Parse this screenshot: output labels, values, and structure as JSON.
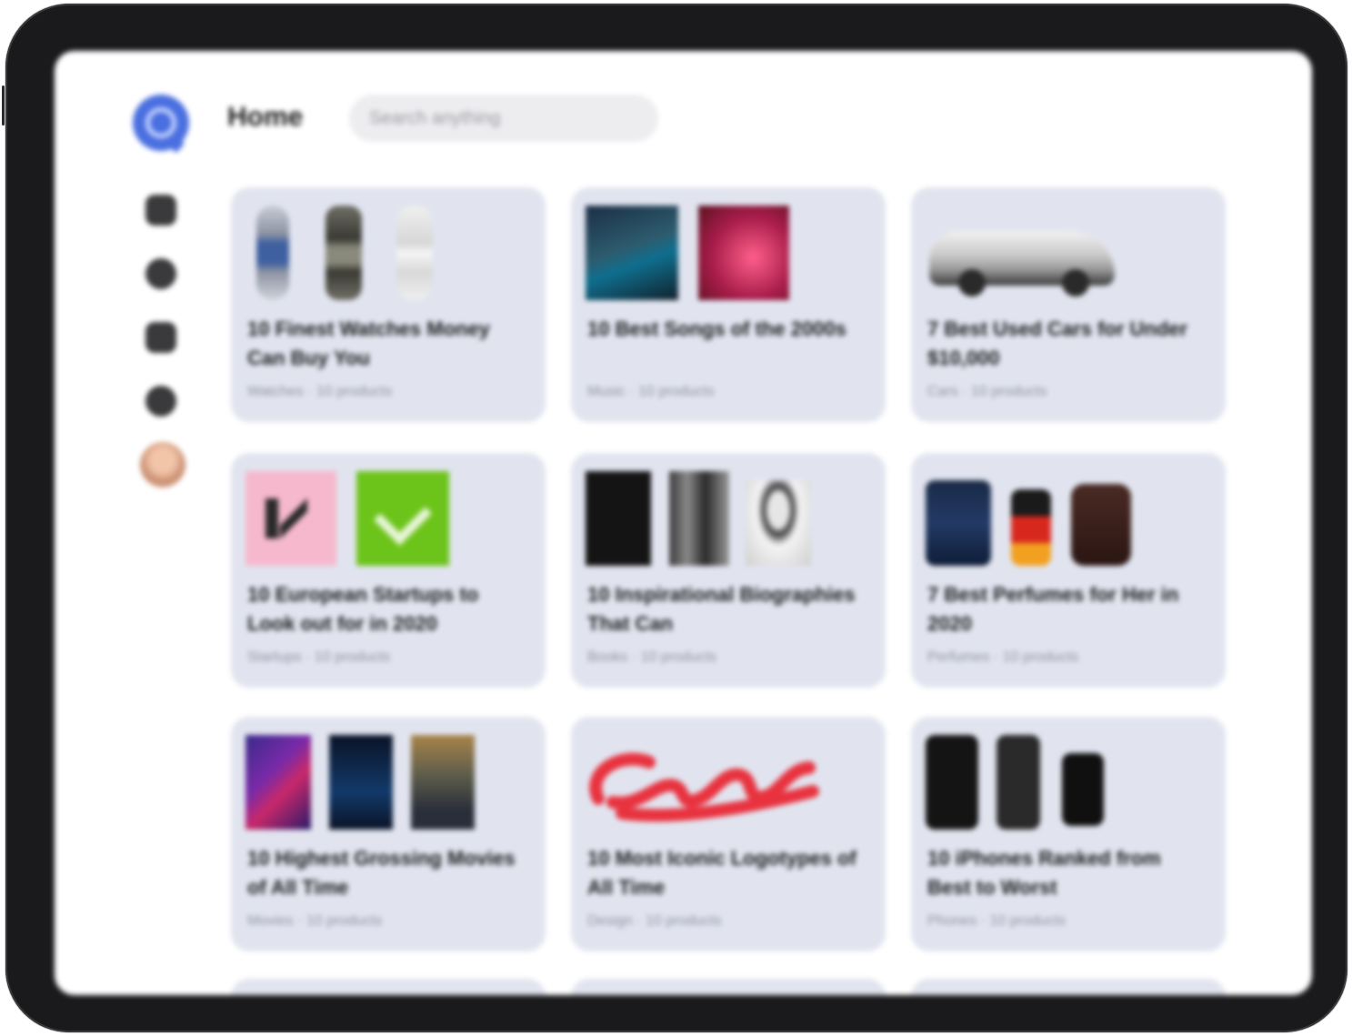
{
  "header": {
    "title": "Home",
    "search_placeholder": "Search anything"
  },
  "sidebar": {
    "items": [
      {
        "name": "home-icon"
      },
      {
        "name": "explore-icon"
      },
      {
        "name": "lists-icon"
      },
      {
        "name": "settings-icon"
      }
    ]
  },
  "cards": [
    {
      "title": "10 Finest Watches Money Can Buy You",
      "meta": "Watches · 10 products"
    },
    {
      "title": "10 Best Songs of the 2000s",
      "meta": "Music · 10 products"
    },
    {
      "title": "7 Best Used Cars for Under $10,000",
      "meta": "Cars · 10 products"
    },
    {
      "title": "10 European Startups to Look out for in 2020",
      "meta": "Startups · 10 products"
    },
    {
      "title": "10 Inspirational Biographies That Can",
      "meta": "Books · 10 products"
    },
    {
      "title": "7 Best Perfumes for Her in 2020",
      "meta": "Perfumes · 10 products"
    },
    {
      "title": "10 Highest Grossing Movies of All Time",
      "meta": "Movies · 10 products"
    },
    {
      "title": "10 Most Iconic Logotypes of All Time",
      "meta": "Design · 10 products"
    },
    {
      "title": "10 iPhones Ranked from Best to Worst",
      "meta": "Phones · 10 products"
    }
  ]
}
